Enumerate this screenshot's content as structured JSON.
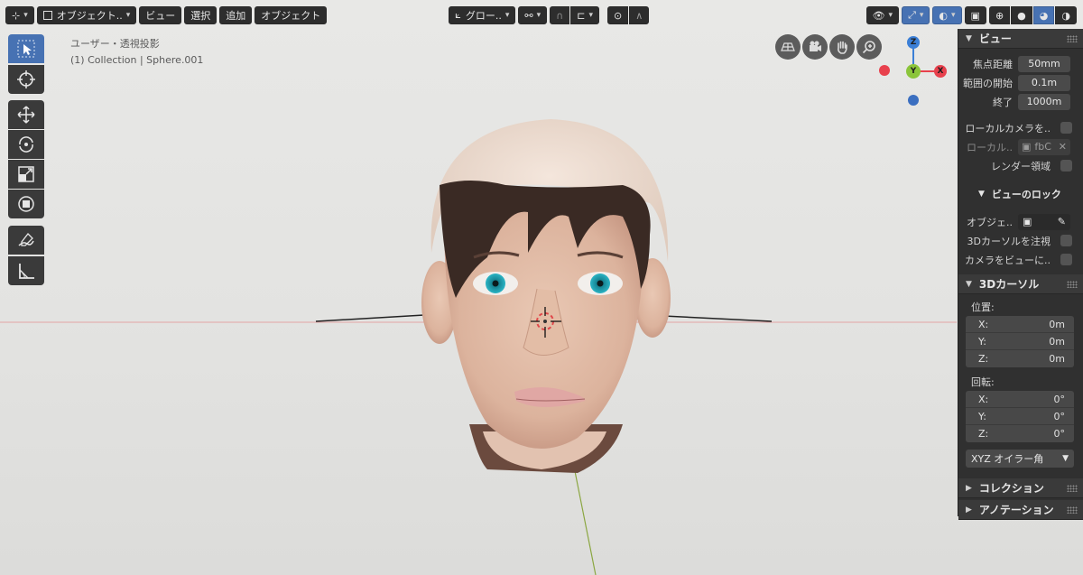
{
  "header": {
    "editor_type_icon": "editor-type-icon",
    "mode": "オブジェクト..",
    "menu": [
      "ビュー",
      "選択",
      "追加",
      "オブジェクト"
    ],
    "transform_orientation": "グロー..",
    "pivot_icon": "pivot-icon",
    "snap_icon": "snap-icon",
    "proportional_icon": "proportional-edit-icon"
  },
  "viewport": {
    "view_name": "ユーザー・透視投影",
    "collection_info": "(1) Collection | Sphere.001"
  },
  "tools": [
    {
      "name": "select-box-tool",
      "icon": "cursor-select-icon",
      "active": true
    },
    {
      "name": "cursor-tool",
      "icon": "3d-cursor-icon",
      "active": false
    },
    {
      "name": "move-tool",
      "icon": "move-icon",
      "active": false
    },
    {
      "name": "rotate-tool",
      "icon": "rotate-icon",
      "active": false
    },
    {
      "name": "scale-tool",
      "icon": "scale-icon",
      "active": false
    },
    {
      "name": "transform-tool",
      "icon": "transform-icon",
      "active": false
    },
    {
      "name": "annotate-tool",
      "icon": "annotate-pen-icon",
      "active": false
    },
    {
      "name": "measure-tool",
      "icon": "measure-icon",
      "active": false
    }
  ],
  "gizmo": {
    "z_label": "Z",
    "y_label": "Y",
    "x_label": "X"
  },
  "panel": {
    "view_section": {
      "title": "ビュー",
      "focal_length_label": "焦点距離",
      "focal_length_value": "50mm",
      "clip_start_label": "範囲の開始",
      "clip_start_value": "0.1m",
      "clip_end_label": "終了",
      "clip_end_value": "1000m",
      "local_camera_label": "ローカルカメラを..",
      "local_label": "ローカル..",
      "local_value": "fbC",
      "render_region_label": "レンダー領域"
    },
    "view_lock_section": {
      "title": "ビューのロック",
      "object_label": "オブジェ..",
      "lock_cursor_label": "3Dカーソルを注視",
      "camera_to_view_label": "カメラをビューに.."
    },
    "cursor_section": {
      "title": "3Dカーソル",
      "location_label": "位置:",
      "location": [
        {
          "axis": "X:",
          "value": "0m"
        },
        {
          "axis": "Y:",
          "value": "0m"
        },
        {
          "axis": "Z:",
          "value": "0m"
        }
      ],
      "rotation_label": "回転:",
      "rotation": [
        {
          "axis": "X:",
          "value": "0°"
        },
        {
          "axis": "Y:",
          "value": "0°"
        },
        {
          "axis": "Z:",
          "value": "0°"
        }
      ],
      "rotation_mode": "XYZ オイラー角"
    },
    "collection_section": {
      "title": "コレクション"
    },
    "annotation_section": {
      "title": "アノテーション"
    }
  },
  "colors": {
    "accent": "#4772b3",
    "axis_x": "#e8414d",
    "axis_y": "#8bc53b",
    "axis_z": "#3b7fd6",
    "panel_bg": "#303030"
  }
}
